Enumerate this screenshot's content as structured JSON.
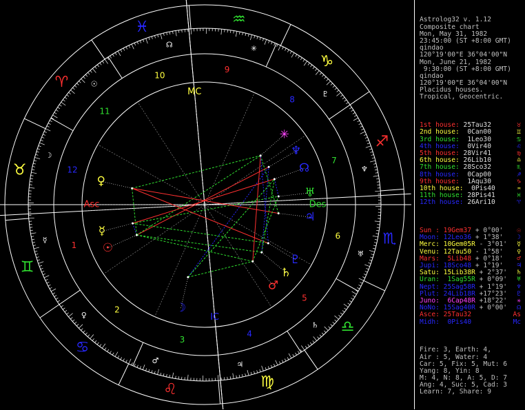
{
  "header": {
    "lines": [
      "Astrolog32 v. 1.12",
      "Composite chart",
      "Mon, May 31, 1982",
      "23:45:00 (ST +8:00 GMT)",
      "qindao",
      "120°19'00\"E 36°04'00\"N",
      "Mon, June 21, 1982",
      " 9:30:00 (ST +8:00 GMT)",
      "qindao",
      "120°19'00\"E 36°04'00\"N",
      "Placidus houses.",
      "Tropical, Geocentric."
    ]
  },
  "houses": [
    {
      "label": "1st house:",
      "pos": "25Tau32",
      "color": "#ff3030",
      "glyph": "♉"
    },
    {
      "label": "2nd house:",
      "pos": " 0Can00",
      "color": "#ffff40",
      "glyph": "♊"
    },
    {
      "label": "3rd house:",
      "pos": " 1Leo30",
      "color": "#30e030",
      "glyph": "♋"
    },
    {
      "label": "4th house:",
      "pos": " 0Vir40",
      "color": "#2828ff",
      "glyph": "♌"
    },
    {
      "label": "5th house:",
      "pos": "28Vir41",
      "color": "#ff3030",
      "glyph": "♍"
    },
    {
      "label": "6th house:",
      "pos": "26Lib10",
      "color": "#ffff40",
      "glyph": "♎"
    },
    {
      "label": "7th house:",
      "pos": "28Sco32",
      "color": "#30e030",
      "glyph": "♏"
    },
    {
      "label": "8th house:",
      "pos": " 0Cap00",
      "color": "#2828ff",
      "glyph": "♐"
    },
    {
      "label": "9th house:",
      "pos": " 1Aqu30",
      "color": "#ff3030",
      "glyph": "♑"
    },
    {
      "label": "10th house:",
      "pos": " 0Pis40",
      "color": "#ffff40",
      "glyph": "♒"
    },
    {
      "label": "11th house:",
      "pos": "28Pis41",
      "color": "#30e030",
      "glyph": "♓"
    },
    {
      "label": "12th house:",
      "pos": "26Ari10",
      "color": "#2828ff",
      "glyph": "♈"
    }
  ],
  "planets": [
    {
      "name": "Sun :",
      "pos": " 19Gem37",
      "motion": " + 0°00'",
      "color": "#ff3030",
      "glyph": "☉"
    },
    {
      "name": "Moon:",
      "pos": " 12Leo36",
      "motion": " + 1°38'",
      "color": "#2828ff",
      "glyph": "☽"
    },
    {
      "name": "Merc:",
      "pos": " 10Gem05R",
      "motion": " - 3°01'",
      "color": "#ffff40",
      "glyph": "☿"
    },
    {
      "name": "Venu:",
      "pos": " 12Tau50",
      "motion": " - 1°58'",
      "color": "#ffff40",
      "glyph": "♀"
    },
    {
      "name": "Mars:",
      "pos": "  5Lib48",
      "motion": " + 0°18'",
      "color": "#ff3030",
      "glyph": "♂"
    },
    {
      "name": "Jupi:",
      "pos": " 18Sco48",
      "motion": " + 1°19'",
      "color": "#2828ff",
      "glyph": "♃"
    },
    {
      "name": "Satu:",
      "pos": " 15Lib38R",
      "motion": " + 2°37'",
      "color": "#ffff40",
      "glyph": "♄"
    },
    {
      "name": "Uran:",
      "pos": "  1Sag55R",
      "motion": " + 0°09'",
      "color": "#30e030",
      "glyph": "♅"
    },
    {
      "name": "Nept:",
      "pos": " 25Sag58R",
      "motion": " + 1°19'",
      "color": "#2828ff",
      "glyph": "♆"
    },
    {
      "name": "Plut:",
      "pos": " 24Lib18R",
      "motion": " +17°23'",
      "color": "#2828ff",
      "glyph": "♇"
    },
    {
      "name": "Juno:",
      "pos": "  6Cap48R",
      "motion": " +18°22'",
      "color": "#ff40ff",
      "glyph": "✳"
    },
    {
      "name": "NoNo:",
      "pos": " 15Sag40R",
      "motion": " + 0°00'",
      "color": "#2828ff",
      "glyph": "☊"
    },
    {
      "name": "Asce:",
      "pos": " 25Tau32",
      "motion": "",
      "color": "#ff3030",
      "glyph": "As"
    },
    {
      "name": "Midh:",
      "pos": "  0Pis40",
      "motion": "",
      "color": "#2828ff",
      "glyph": "Mc"
    }
  ],
  "stats": [
    "Fire: 3, Earth: 4,",
    "Air : 5, Water: 4",
    "Car: 5, Fix: 5, Mut: 6",
    "Yang: 8, Yin: 8",
    "M: 4, N: 8, A: 5, D: 7",
    "Ang: 4, Suc: 5, Cad: 3",
    "Learn: 7, Share: 9"
  ],
  "chart_data": {
    "type": "astrological-wheel",
    "signs": [
      {
        "name": "Aries",
        "glyph": "♈",
        "color": "#ff3030"
      },
      {
        "name": "Taurus",
        "glyph": "♉",
        "color": "#ffff40"
      },
      {
        "name": "Gemini",
        "glyph": "♊",
        "color": "#30e030"
      },
      {
        "name": "Cancer",
        "glyph": "♋",
        "color": "#2828ff"
      },
      {
        "name": "Leo",
        "glyph": "♌",
        "color": "#ff3030"
      },
      {
        "name": "Virgo",
        "glyph": "♍",
        "color": "#ffff40"
      },
      {
        "name": "Libra",
        "glyph": "♎",
        "color": "#30e030"
      },
      {
        "name": "Scorpio",
        "glyph": "♏",
        "color": "#2828ff"
      },
      {
        "name": "Sagittarius",
        "glyph": "♐",
        "color": "#ff3030"
      },
      {
        "name": "Capricorn",
        "glyph": "♑",
        "color": "#ffff40"
      },
      {
        "name": "Aquarius",
        "glyph": "♒",
        "color": "#30e030"
      },
      {
        "name": "Pisces",
        "glyph": "♓",
        "color": "#2828ff"
      }
    ],
    "house_cusps_deg": [
      55.53,
      90.0,
      121.5,
      150.67,
      178.68,
      206.17,
      238.53,
      270.0,
      301.5,
      330.67,
      358.68,
      26.17
    ],
    "house_numbers": [
      "1",
      "2",
      "3",
      "4",
      "5",
      "6",
      "7",
      "8",
      "9",
      "10",
      "11",
      "12"
    ],
    "ascendant_deg": 55.53,
    "midheaven_deg": 330.67,
    "axis_labels": {
      "asc": "Asc",
      "desc": "Des",
      "mc": "MC",
      "ic": "IC"
    },
    "bodies": [
      {
        "glyph": "☉",
        "deg": 79.62,
        "color": "#ff3030"
      },
      {
        "glyph": "☽",
        "deg": 132.6,
        "color": "#2828ff"
      },
      {
        "glyph": "☿",
        "deg": 70.08,
        "color": "#ffff40"
      },
      {
        "glyph": "♀",
        "deg": 42.83,
        "color": "#ffff40"
      },
      {
        "glyph": "♂",
        "deg": 185.8,
        "color": "#ff3030"
      },
      {
        "glyph": "♃",
        "deg": 228.8,
        "color": "#2828ff"
      },
      {
        "glyph": "♄",
        "deg": 195.63,
        "color": "#ffff40"
      },
      {
        "glyph": "♅",
        "deg": 241.92,
        "color": "#30e030"
      },
      {
        "glyph": "♆",
        "deg": 265.97,
        "color": "#2828ff"
      },
      {
        "glyph": "♇",
        "deg": 204.3,
        "color": "#2828ff"
      },
      {
        "glyph": "✳",
        "deg": 276.8,
        "color": "#ff40ff"
      },
      {
        "glyph": "☊",
        "deg": 255.67,
        "color": "#2828ff"
      }
    ],
    "aspects": [
      {
        "a": 0,
        "b": 2,
        "color": "#2828ff"
      },
      {
        "a": 0,
        "b": 3,
        "color": "#30e030"
      },
      {
        "a": 0,
        "b": 4,
        "color": "#30e030"
      },
      {
        "a": 0,
        "b": 6,
        "color": "#30e030"
      },
      {
        "a": 0,
        "b": 8,
        "color": "#ff3030"
      },
      {
        "a": 0,
        "b": 10,
        "color": "#30e030"
      },
      {
        "a": 1,
        "b": 8,
        "color": "#2828ff"
      },
      {
        "a": 1,
        "b": 4,
        "color": "#30e030"
      },
      {
        "a": 2,
        "b": 7,
        "color": "#30e030"
      },
      {
        "a": 2,
        "b": 9,
        "color": "#30e030"
      },
      {
        "a": 2,
        "b": 11,
        "color": "#ff3030"
      },
      {
        "a": 3,
        "b": 9,
        "color": "#ff3030"
      },
      {
        "a": 3,
        "b": 10,
        "color": "#30e030"
      },
      {
        "a": 3,
        "b": 5,
        "color": "#ff3030"
      },
      {
        "a": 4,
        "b": 7,
        "color": "#30e030"
      },
      {
        "a": 4,
        "b": 10,
        "color": "#ff3030"
      },
      {
        "a": 5,
        "b": 10,
        "color": "#30e030"
      },
      {
        "a": 6,
        "b": 11,
        "color": "#30e030"
      },
      {
        "a": 6,
        "b": 8,
        "color": "#2828ff"
      },
      {
        "a": 7,
        "b": 11,
        "color": "#2828ff"
      },
      {
        "a": 9,
        "b": 10,
        "color": "#2828ff"
      },
      {
        "a": 1,
        "b": 11,
        "color": "#30e030"
      }
    ]
  }
}
